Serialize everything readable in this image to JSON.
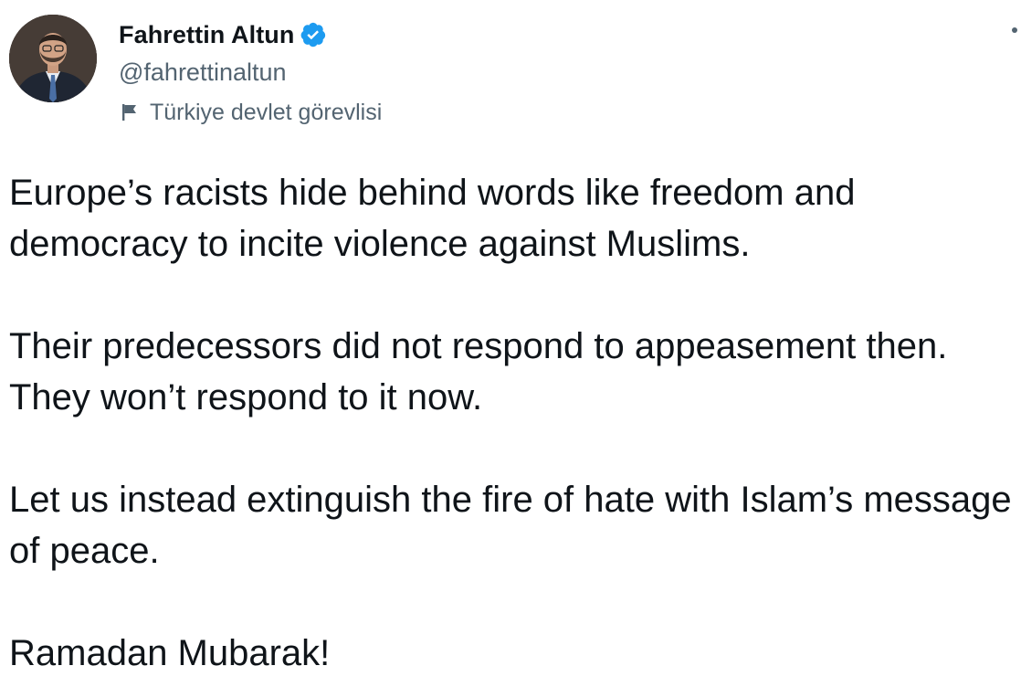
{
  "author": {
    "display_name": "Fahrettin Altun",
    "handle": "@fahrettinaltun",
    "verified": true,
    "label": "Türkiye devlet görevlisi"
  },
  "tweet": {
    "paragraphs": [
      "Europe’s racists hide behind words like freedom and democracy to incite violence against Muslims.",
      "Their predecessors did not respond to appeasement then. They won’t respond to it now.",
      "Let us instead extinguish the fire of hate with Islam’s message of peace.",
      "Ramadan Mubarak!"
    ]
  },
  "colors": {
    "verified_blue": "#1d9bf0",
    "secondary_text": "#536471",
    "primary_text": "#0f1419"
  },
  "icons": {
    "verified": "verified-badge-icon",
    "label": "flag-icon",
    "more": "more-options-icon"
  }
}
